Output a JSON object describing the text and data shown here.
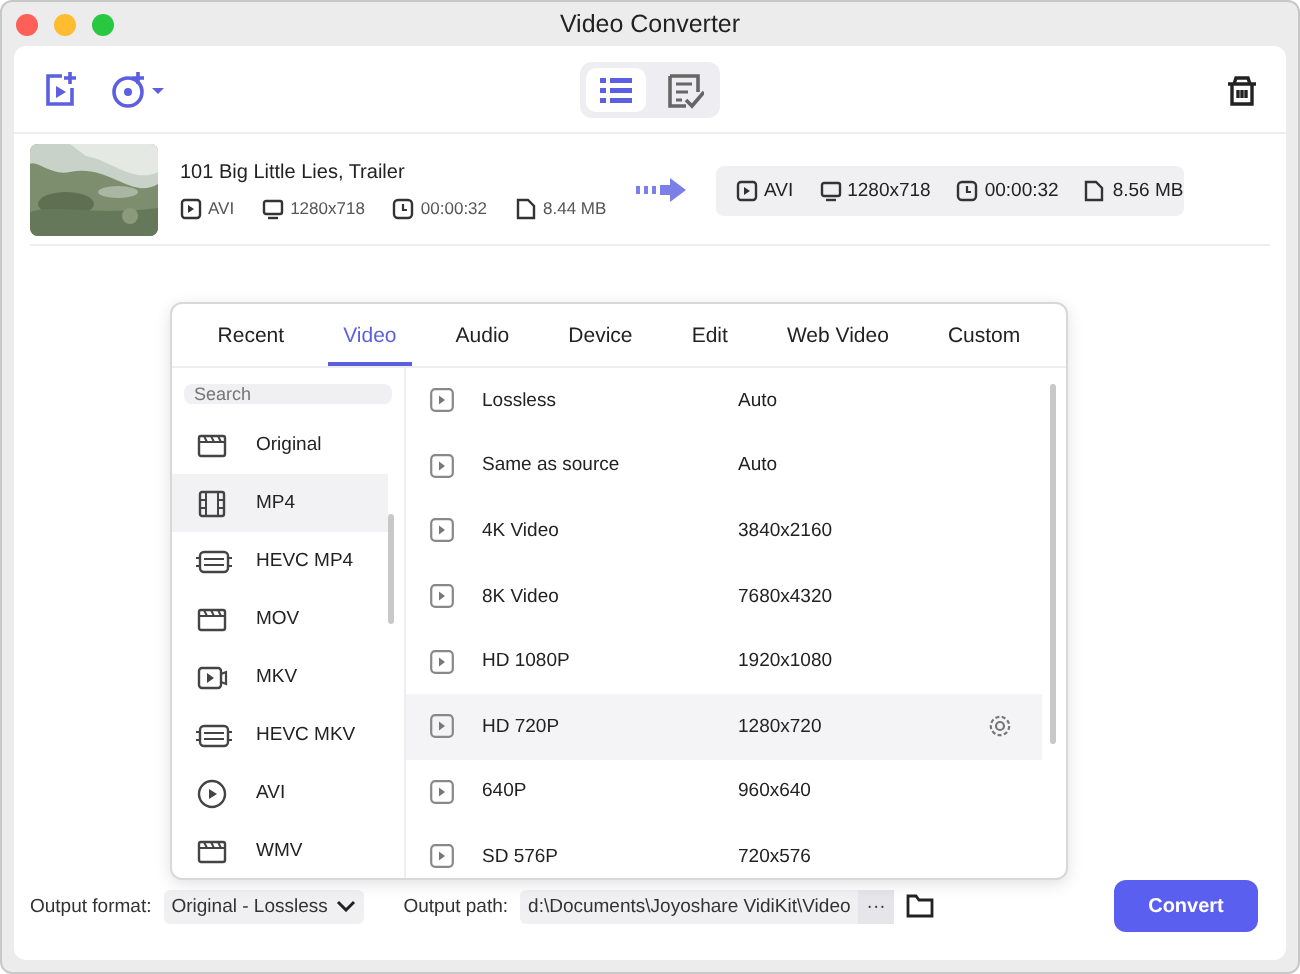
{
  "window": {
    "title": "Video Converter"
  },
  "toolbar": {
    "views": [
      {
        "kind": "list",
        "selected": true
      },
      {
        "kind": "tasks",
        "selected": false
      }
    ]
  },
  "file": {
    "name": "101 Big Little Lies, Trailer",
    "source": {
      "format": "AVI",
      "resolution": "1280x718",
      "duration": "00:00:32",
      "size": "8.44 MB"
    },
    "target": {
      "format": "AVI",
      "resolution": "1280x718",
      "duration": "00:00:32",
      "size": "8.56 MB"
    }
  },
  "format_panel": {
    "tabs": [
      {
        "label": "Recent",
        "selected": false
      },
      {
        "label": "Video",
        "selected": true
      },
      {
        "label": "Audio",
        "selected": false
      },
      {
        "label": "Device",
        "selected": false
      },
      {
        "label": "Edit",
        "selected": false
      },
      {
        "label": "Web Video",
        "selected": false
      },
      {
        "label": "Custom",
        "selected": false
      }
    ],
    "search": {
      "placeholder": "Search"
    },
    "formats": [
      {
        "label": "Original",
        "kind": "clapper",
        "selected": false
      },
      {
        "label": "MP4",
        "kind": "film",
        "selected": true
      },
      {
        "label": "HEVC MP4",
        "kind": "hevc",
        "selected": false
      },
      {
        "label": "MOV",
        "kind": "clapper",
        "selected": false
      },
      {
        "label": "MKV",
        "kind": "video",
        "selected": false
      },
      {
        "label": "HEVC MKV",
        "kind": "hevc",
        "selected": false
      },
      {
        "label": "AVI",
        "kind": "play",
        "selected": false
      },
      {
        "label": "WMV",
        "kind": "clapper",
        "selected": false
      }
    ],
    "presets": [
      {
        "name": "Lossless",
        "resolution": "Auto",
        "selected": false
      },
      {
        "name": "Same as source",
        "resolution": "Auto",
        "selected": false
      },
      {
        "name": "4K Video",
        "resolution": "3840x2160",
        "selected": false
      },
      {
        "name": "8K Video",
        "resolution": "7680x4320",
        "selected": false
      },
      {
        "name": "HD 1080P",
        "resolution": "1920x1080",
        "selected": false
      },
      {
        "name": "HD 720P",
        "resolution": "1280x720",
        "selected": true
      },
      {
        "name": "640P",
        "resolution": "960x640",
        "selected": false
      },
      {
        "name": "SD 576P",
        "resolution": "720x576",
        "selected": false
      }
    ]
  },
  "bottom_bar": {
    "output_format_label": "Output format:",
    "output_format": "Original - Lossless",
    "output_path_label": "Output path:",
    "output_path": "d:\\Documents\\Joyoshare VidiKit\\Video",
    "more_button": "···",
    "convert_button": "Convert"
  }
}
